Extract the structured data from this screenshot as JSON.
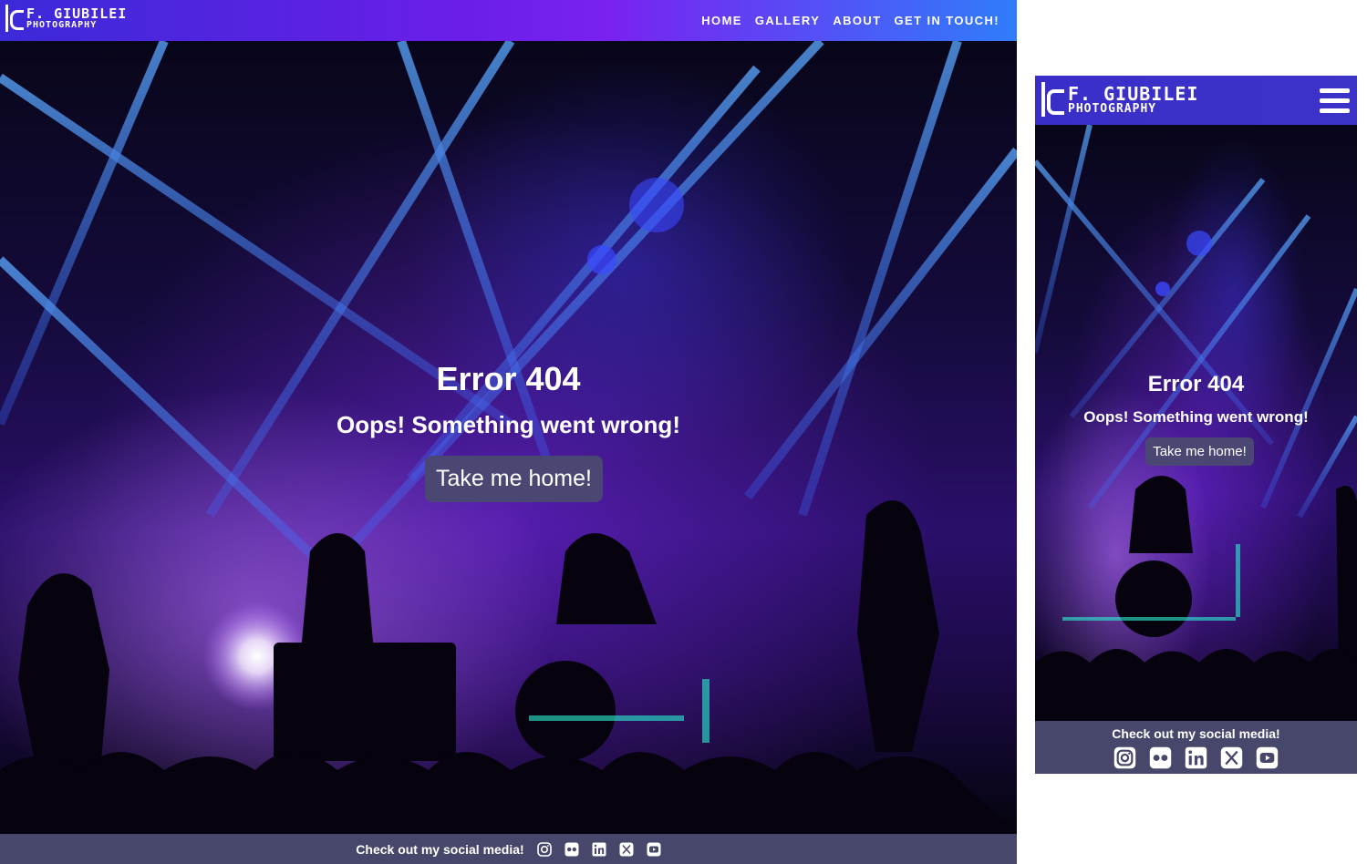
{
  "brand": {
    "line1": "F. GIUBILEI",
    "line2": "PHOTOGRAPHY"
  },
  "nav": {
    "items": [
      {
        "label": "HOME"
      },
      {
        "label": "GALLERY"
      },
      {
        "label": "ABOUT"
      },
      {
        "label": "GET IN TOUCH!"
      }
    ]
  },
  "hero": {
    "title": "Error 404",
    "subtitle": "Oops! Something went wrong!",
    "button_label": "Take me home!"
  },
  "footer": {
    "text": "Check out my social media!",
    "socials": [
      "instagram-icon",
      "flickr-icon",
      "linkedin-icon",
      "x-icon",
      "youtube-icon"
    ]
  },
  "colors": {
    "nav_gradient_start": "#3b2ad8",
    "nav_gradient_end": "#2f7dfb",
    "mobile_nav": "#3a2ec8",
    "footer_bg": "#47476b",
    "button_bg": "#4a4873"
  }
}
